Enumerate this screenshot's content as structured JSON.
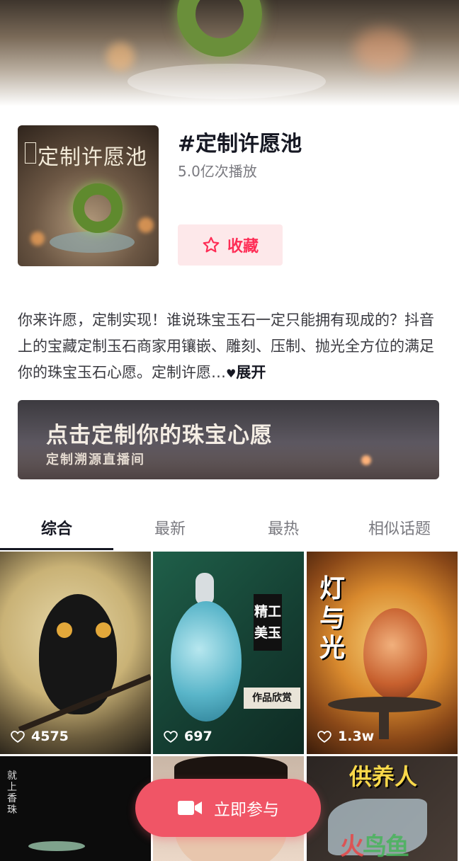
{
  "header": {
    "title": "#定制许愿池",
    "plays": "5.0亿次播放",
    "cover_text": "定制许愿池",
    "favorite_label": "收藏"
  },
  "description": {
    "text": "你来许愿，定制实现！谁说珠宝玉石一定只能拥有现成的？抖音上的宝藏定制玉石商家用镶嵌、雕刻、压制、抛光全方位的满足你的珠宝玉石心愿。定制许愿…",
    "expand_label": "展开"
  },
  "banner": {
    "title": "点击定制你的珠宝心愿",
    "subtitle": "定制溯源直播间"
  },
  "tabs": [
    {
      "label": "综合",
      "active": true
    },
    {
      "label": "最新",
      "active": false
    },
    {
      "label": "最热",
      "active": false
    },
    {
      "label": "相似话题",
      "active": false
    }
  ],
  "videos": [
    {
      "likes": "4575"
    },
    {
      "likes": "697",
      "vertical_label": "精工美玉",
      "tag": "作品欣赏"
    },
    {
      "likes": "1.3w",
      "vertical_label": "灯与光"
    },
    {
      "vertical_label": "就上香珠"
    },
    {},
    {
      "headline": "供养人"
    }
  ],
  "join_button": {
    "label": "立即参与"
  },
  "watermark": {
    "text1": "火",
    "text2": "鸟",
    "text3": "鱼"
  },
  "colors": {
    "accent": "#fe2c55",
    "join": "#f05566",
    "fav_bg": "#fde8ea"
  }
}
